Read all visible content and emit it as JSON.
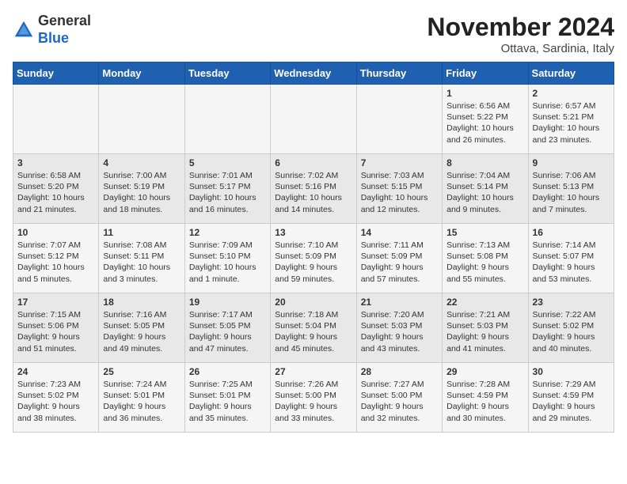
{
  "logo": {
    "general": "General",
    "blue": "Blue"
  },
  "title": "November 2024",
  "location": "Ottava, Sardinia, Italy",
  "days_of_week": [
    "Sunday",
    "Monday",
    "Tuesday",
    "Wednesday",
    "Thursday",
    "Friday",
    "Saturday"
  ],
  "weeks": [
    [
      {
        "day": "",
        "content": ""
      },
      {
        "day": "",
        "content": ""
      },
      {
        "day": "",
        "content": ""
      },
      {
        "day": "",
        "content": ""
      },
      {
        "day": "",
        "content": ""
      },
      {
        "day": "1",
        "content": "Sunrise: 6:56 AM\nSunset: 5:22 PM\nDaylight: 10 hours\nand 26 minutes."
      },
      {
        "day": "2",
        "content": "Sunrise: 6:57 AM\nSunset: 5:21 PM\nDaylight: 10 hours\nand 23 minutes."
      }
    ],
    [
      {
        "day": "3",
        "content": "Sunrise: 6:58 AM\nSunset: 5:20 PM\nDaylight: 10 hours\nand 21 minutes."
      },
      {
        "day": "4",
        "content": "Sunrise: 7:00 AM\nSunset: 5:19 PM\nDaylight: 10 hours\nand 18 minutes."
      },
      {
        "day": "5",
        "content": "Sunrise: 7:01 AM\nSunset: 5:17 PM\nDaylight: 10 hours\nand 16 minutes."
      },
      {
        "day": "6",
        "content": "Sunrise: 7:02 AM\nSunset: 5:16 PM\nDaylight: 10 hours\nand 14 minutes."
      },
      {
        "day": "7",
        "content": "Sunrise: 7:03 AM\nSunset: 5:15 PM\nDaylight: 10 hours\nand 12 minutes."
      },
      {
        "day": "8",
        "content": "Sunrise: 7:04 AM\nSunset: 5:14 PM\nDaylight: 10 hours\nand 9 minutes."
      },
      {
        "day": "9",
        "content": "Sunrise: 7:06 AM\nSunset: 5:13 PM\nDaylight: 10 hours\nand 7 minutes."
      }
    ],
    [
      {
        "day": "10",
        "content": "Sunrise: 7:07 AM\nSunset: 5:12 PM\nDaylight: 10 hours\nand 5 minutes."
      },
      {
        "day": "11",
        "content": "Sunrise: 7:08 AM\nSunset: 5:11 PM\nDaylight: 10 hours\nand 3 minutes."
      },
      {
        "day": "12",
        "content": "Sunrise: 7:09 AM\nSunset: 5:10 PM\nDaylight: 10 hours\nand 1 minute."
      },
      {
        "day": "13",
        "content": "Sunrise: 7:10 AM\nSunset: 5:09 PM\nDaylight: 9 hours\nand 59 minutes."
      },
      {
        "day": "14",
        "content": "Sunrise: 7:11 AM\nSunset: 5:09 PM\nDaylight: 9 hours\nand 57 minutes."
      },
      {
        "day": "15",
        "content": "Sunrise: 7:13 AM\nSunset: 5:08 PM\nDaylight: 9 hours\nand 55 minutes."
      },
      {
        "day": "16",
        "content": "Sunrise: 7:14 AM\nSunset: 5:07 PM\nDaylight: 9 hours\nand 53 minutes."
      }
    ],
    [
      {
        "day": "17",
        "content": "Sunrise: 7:15 AM\nSunset: 5:06 PM\nDaylight: 9 hours\nand 51 minutes."
      },
      {
        "day": "18",
        "content": "Sunrise: 7:16 AM\nSunset: 5:05 PM\nDaylight: 9 hours\nand 49 minutes."
      },
      {
        "day": "19",
        "content": "Sunrise: 7:17 AM\nSunset: 5:05 PM\nDaylight: 9 hours\nand 47 minutes."
      },
      {
        "day": "20",
        "content": "Sunrise: 7:18 AM\nSunset: 5:04 PM\nDaylight: 9 hours\nand 45 minutes."
      },
      {
        "day": "21",
        "content": "Sunrise: 7:20 AM\nSunset: 5:03 PM\nDaylight: 9 hours\nand 43 minutes."
      },
      {
        "day": "22",
        "content": "Sunrise: 7:21 AM\nSunset: 5:03 PM\nDaylight: 9 hours\nand 41 minutes."
      },
      {
        "day": "23",
        "content": "Sunrise: 7:22 AM\nSunset: 5:02 PM\nDaylight: 9 hours\nand 40 minutes."
      }
    ],
    [
      {
        "day": "24",
        "content": "Sunrise: 7:23 AM\nSunset: 5:02 PM\nDaylight: 9 hours\nand 38 minutes."
      },
      {
        "day": "25",
        "content": "Sunrise: 7:24 AM\nSunset: 5:01 PM\nDaylight: 9 hours\nand 36 minutes."
      },
      {
        "day": "26",
        "content": "Sunrise: 7:25 AM\nSunset: 5:01 PM\nDaylight: 9 hours\nand 35 minutes."
      },
      {
        "day": "27",
        "content": "Sunrise: 7:26 AM\nSunset: 5:00 PM\nDaylight: 9 hours\nand 33 minutes."
      },
      {
        "day": "28",
        "content": "Sunrise: 7:27 AM\nSunset: 5:00 PM\nDaylight: 9 hours\nand 32 minutes."
      },
      {
        "day": "29",
        "content": "Sunrise: 7:28 AM\nSunset: 4:59 PM\nDaylight: 9 hours\nand 30 minutes."
      },
      {
        "day": "30",
        "content": "Sunrise: 7:29 AM\nSunset: 4:59 PM\nDaylight: 9 hours\nand 29 minutes."
      }
    ]
  ]
}
